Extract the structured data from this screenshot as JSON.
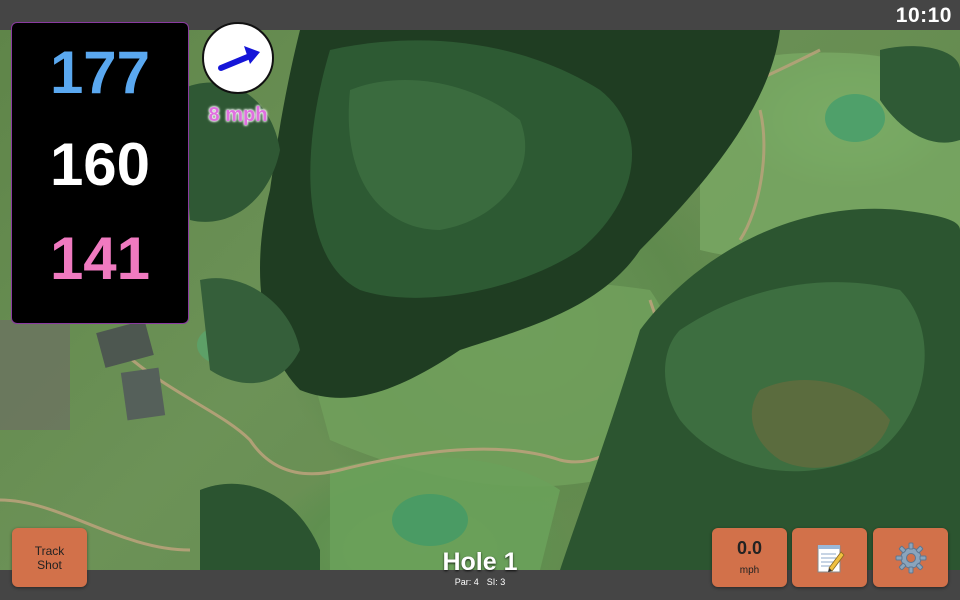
{
  "status": {
    "time": "10:10"
  },
  "distances": {
    "back": "177",
    "middle": "160",
    "front": "141"
  },
  "wind": {
    "speed": "8 mph",
    "icon": "wind-arrow-icon"
  },
  "hole": {
    "title": "Hole 1",
    "par": "Par: 4",
    "stroke_index": "SI: 3"
  },
  "buttons": {
    "track_shot": "Track Shot",
    "speed_value": "0.0",
    "speed_unit": "mph",
    "notes_icon": "notepad-icon",
    "settings_icon": "gear-icon"
  },
  "colors": {
    "back_distance": "#5aa8f0",
    "middle_distance": "#ffffff",
    "front_distance": "#f07ac0",
    "button": "#d2714a",
    "wind_text": "#e070e0"
  }
}
